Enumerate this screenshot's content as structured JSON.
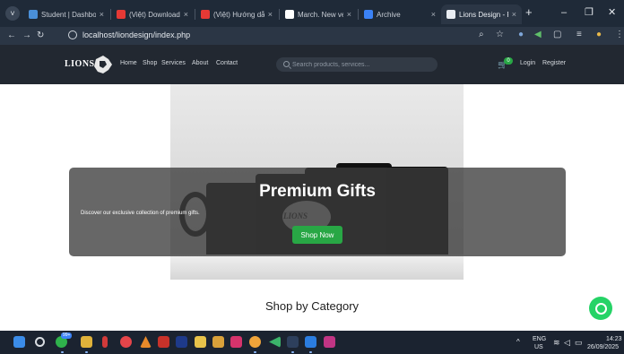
{
  "browser": {
    "tabs": [
      {
        "title": "Student | Dashboard",
        "color": "#4a90d9"
      },
      {
        "title": "(Việt) Download All",
        "color": "#e53935"
      },
      {
        "title": "(Việt) Hướng dẫn",
        "color": "#e53935"
      },
      {
        "title": "March. New version",
        "color": "#ffffff"
      },
      {
        "title": "Archive",
        "color": "#3b82f6"
      },
      {
        "title": "Lions Design - Premium",
        "color": "#1f2a38"
      }
    ],
    "url": "localhost/liondesign/index.php",
    "new_tab_label": "+",
    "window_controls": {
      "minimize": "–",
      "restore": "❐",
      "close": "✕"
    }
  },
  "site": {
    "logo_text": "LIONS",
    "nav": [
      "Home",
      "Shop",
      "Services",
      "About",
      "Contact"
    ],
    "search_placeholder": "Search products, services...",
    "cart_count": "0",
    "login_label": "Login",
    "register_label": "Register"
  },
  "hero": {
    "title": "Premium Gifts",
    "subtitle": "Discover our exclusive collection of premium gifts.",
    "button_label": "Shop Now",
    "mug_logo_text": "LIONS"
  },
  "section_title": "Shop by Category",
  "taskbar": {
    "badge": "99+",
    "language": "ENG",
    "region": "US",
    "time": "14:23",
    "date": "26/09/2025"
  },
  "colors": {
    "accent": "#28a745",
    "navbar": "#222831",
    "overlay": "rgba(60,60,60,0.78)"
  }
}
